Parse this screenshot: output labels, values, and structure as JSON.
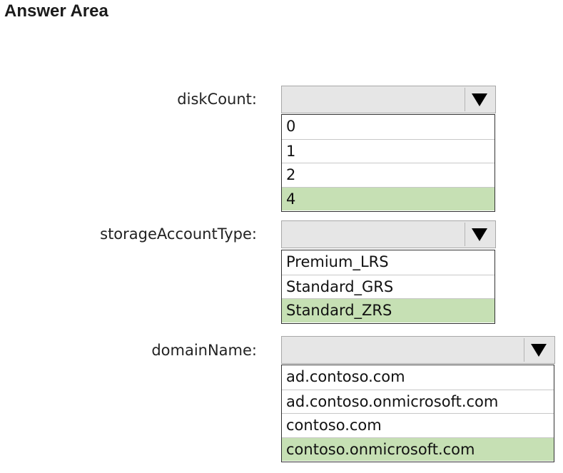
{
  "heading": "Answer Area",
  "fields": [
    {
      "label": "diskCount:",
      "options": [
        "0",
        "1",
        "2",
        "4"
      ],
      "selected_index": 3
    },
    {
      "label": "storageAccountType:",
      "options": [
        "Premium_LRS",
        "Standard_GRS",
        "Standard_ZRS"
      ],
      "selected_index": 2
    },
    {
      "label": "domainName:",
      "options": [
        "ad.contoso.com",
        "ad.contoso.onmicrosoft.com",
        "contoso.com",
        "contoso.onmicrosoft.com"
      ],
      "selected_index": 3
    }
  ],
  "colors": {
    "selected_option": "#c6e0b4",
    "dropdown_background": "#e6e6e6"
  },
  "icons": {
    "dropdown_arrow": "triangle-down-icon"
  }
}
